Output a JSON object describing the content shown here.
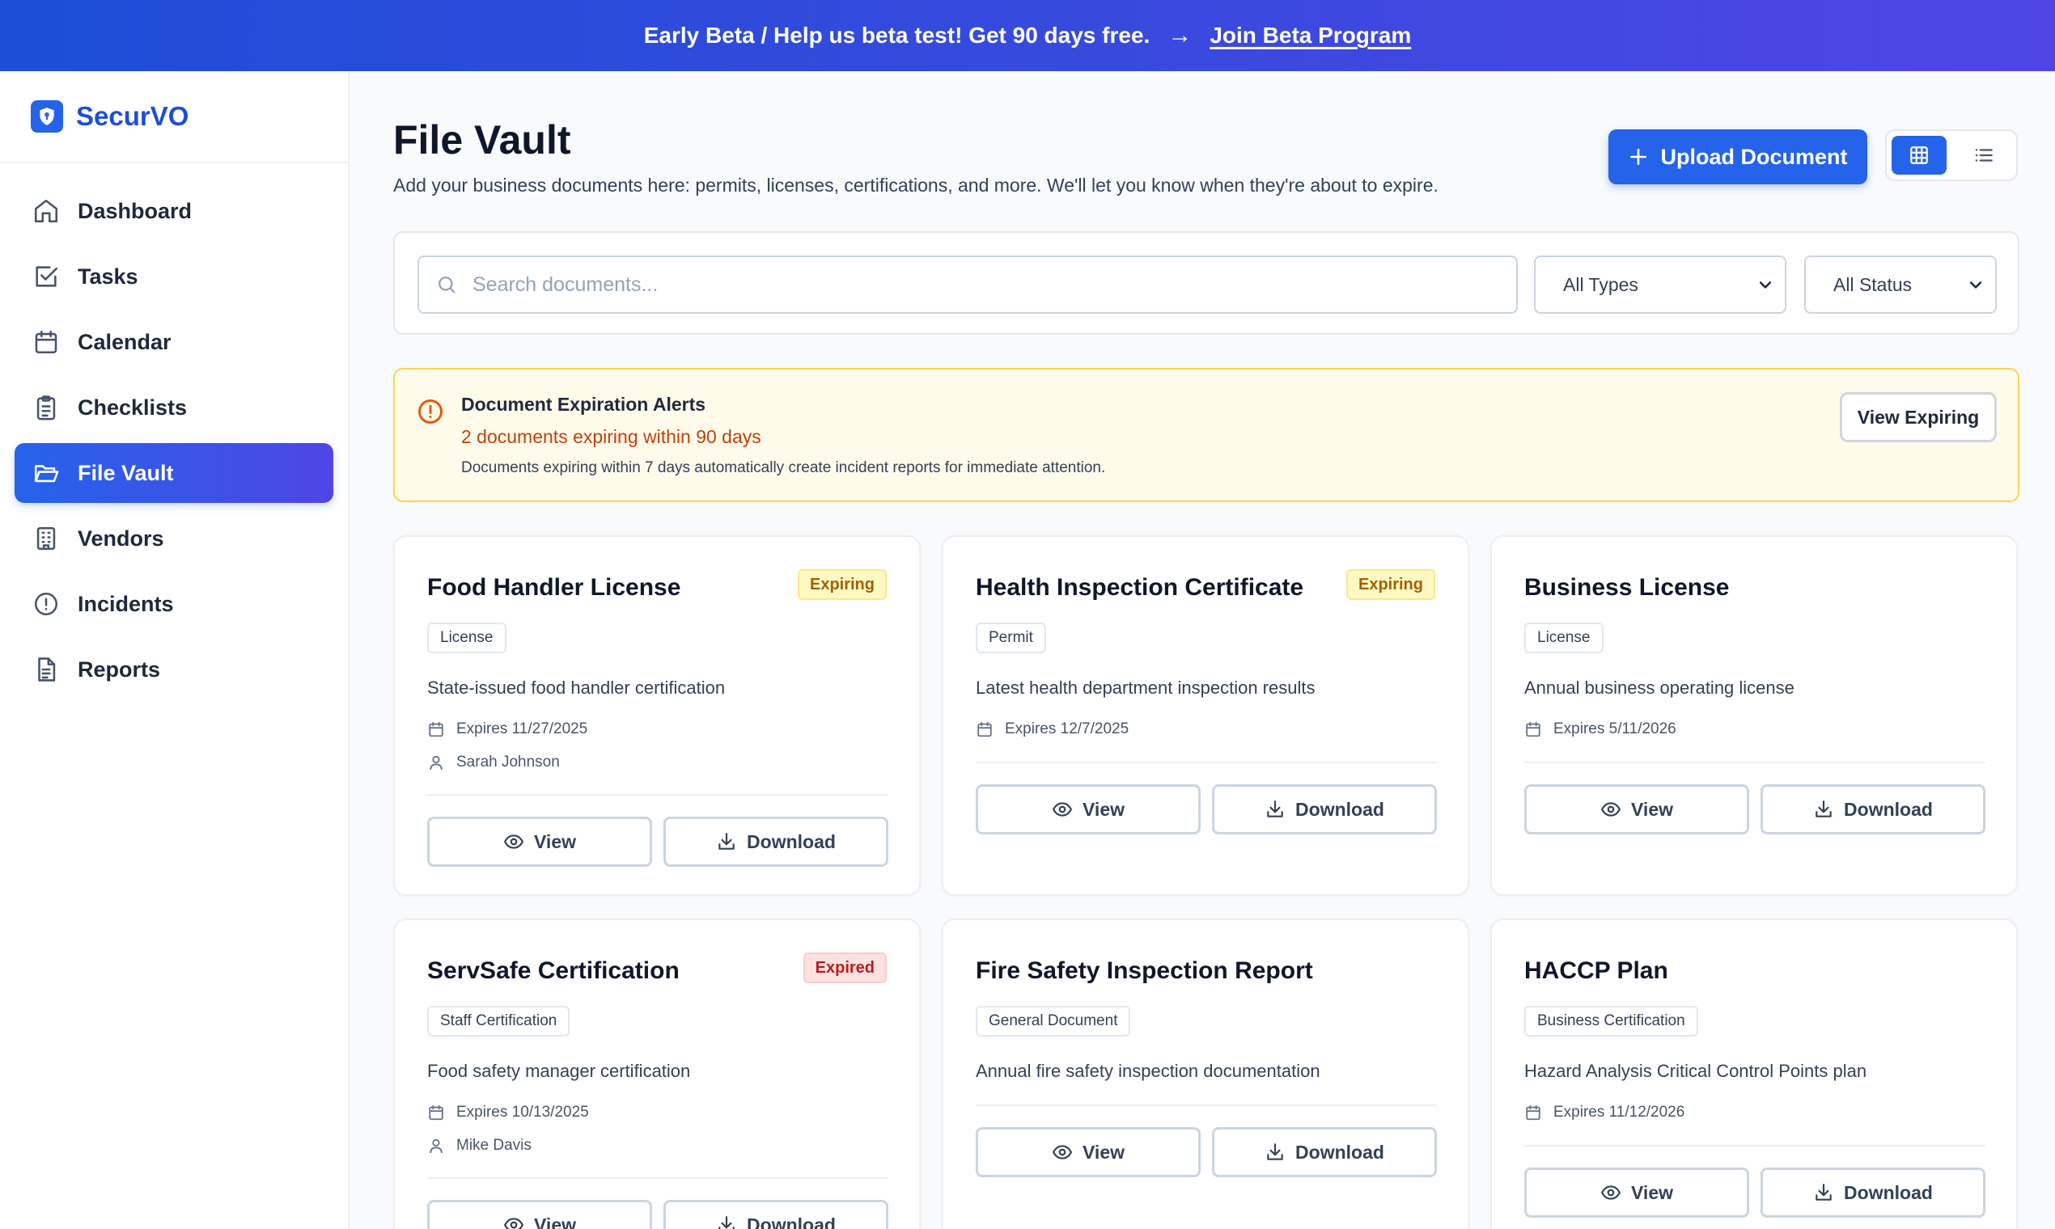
{
  "banner": {
    "text": "Early Beta / Help us beta test! Get 90 days free.",
    "arrow": "→",
    "link": "Join Beta Program"
  },
  "brand": {
    "name": "SecurVO",
    "color": "#1d4ed8"
  },
  "nav": [
    {
      "label": "Dashboard",
      "icon": "home-icon"
    },
    {
      "label": "Tasks",
      "icon": "checkbox-icon"
    },
    {
      "label": "Calendar",
      "icon": "calendar-icon"
    },
    {
      "label": "Checklists",
      "icon": "clipboard-icon"
    },
    {
      "label": "File Vault",
      "icon": "folder-open-icon",
      "active": true
    },
    {
      "label": "Vendors",
      "icon": "building-icon"
    },
    {
      "label": "Incidents",
      "icon": "alert-circle-icon"
    },
    {
      "label": "Reports",
      "icon": "file-text-icon"
    }
  ],
  "page": {
    "title": "File Vault",
    "subtitle": "Add your business documents here: permits, licenses, certifications, and more. We'll let you know when they're about to expire.",
    "upload_label": "Upload Document",
    "view_mode": "grid"
  },
  "filters": {
    "search_placeholder": "Search documents...",
    "type_value": "All Types",
    "status_value": "All Status"
  },
  "alert": {
    "title": "Document Expiration Alerts",
    "count_text": "2 documents expiring within 90 days",
    "note": "Documents expiring within 7 days automatically create incident reports for immediate attention.",
    "button": "View Expiring"
  },
  "card_actions": {
    "view": "View",
    "download": "Download"
  },
  "documents": [
    {
      "title": "Food Handler License",
      "status": "Expiring",
      "type": "License",
      "description": "State-issued food handler certification",
      "expires": "Expires 11/27/2025",
      "assignee": "Sarah Johnson"
    },
    {
      "title": "Health Inspection Certificate",
      "status": "Expiring",
      "type": "Permit",
      "description": "Latest health department inspection results",
      "expires": "Expires 12/7/2025"
    },
    {
      "title": "Business License",
      "status": "",
      "type": "License",
      "description": "Annual business operating license",
      "expires": "Expires 5/11/2026"
    },
    {
      "title": "ServSafe Certification",
      "status": "Expired",
      "type": "Staff Certification",
      "description": "Food safety manager certification",
      "expires": "Expires 10/13/2025",
      "assignee": "Mike Davis"
    },
    {
      "title": "Fire Safety Inspection Report",
      "status": "",
      "type": "General Document",
      "description": "Annual fire safety inspection documentation"
    },
    {
      "title": "HACCP Plan",
      "status": "",
      "type": "Business Certification",
      "description": "Hazard Analysis Critical Control Points plan",
      "expires": "Expires 11/12/2026"
    }
  ]
}
